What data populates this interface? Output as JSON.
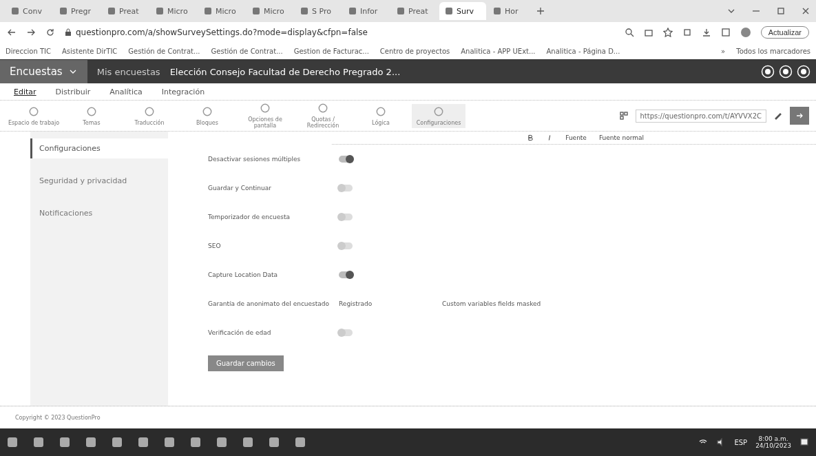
{
  "browser": {
    "tabs": [
      {
        "title": "Conv",
        "selected": false
      },
      {
        "title": "Pregr",
        "selected": false
      },
      {
        "title": "Preat",
        "selected": false
      },
      {
        "title": "Micro",
        "selected": false
      },
      {
        "title": "Micro",
        "selected": false
      },
      {
        "title": "Micro",
        "selected": false
      },
      {
        "title": "S Pro",
        "selected": false
      },
      {
        "title": "Infor",
        "selected": false
      },
      {
        "title": "Preat",
        "selected": false
      },
      {
        "title": "Surv",
        "selected": true
      },
      {
        "title": "Hor",
        "selected": false
      }
    ],
    "url": "questionpro.com/a/showSurveySettings.do?mode=display&cfpn=false",
    "update_button": "Actualizar",
    "bookmarks": [
      "Direccion TIC",
      "Asistente DirTIC",
      "Gestión de Contrat...",
      "Gestión de Contrat...",
      "Gestion de Facturac...",
      "Centro de proyectos",
      "Analitica - APP UExt...",
      "Analitica - Página D..."
    ],
    "more_bookmarks": "»",
    "all_bookmarks": "Todos los marcadores"
  },
  "app_bar": {
    "product": "Encuestas",
    "breadcrumb": "Mis encuestas",
    "survey_title": "Elección Consejo Facultad de Derecho Pregrado 2..."
  },
  "menu": [
    {
      "label": "Editar",
      "selected": true
    },
    {
      "label": "Distribuir",
      "selected": false
    },
    {
      "label": "Analítica",
      "selected": false
    },
    {
      "label": "Integración",
      "selected": false
    }
  ],
  "toolbar": [
    {
      "label": "Espacio de trabajo",
      "selected": false
    },
    {
      "label": "Temas",
      "selected": false
    },
    {
      "label": "Traducción",
      "selected": false
    },
    {
      "label": "Bloques",
      "selected": false
    },
    {
      "label": "Opciones de pantalla",
      "selected": false
    },
    {
      "label": "Quotas / Redirección",
      "selected": false
    },
    {
      "label": "Lógica",
      "selected": false
    },
    {
      "label": "Configuraciones",
      "selected": true
    }
  ],
  "share_url": "https://questionpro.com/t/AYVVX2C",
  "editor_toolbar": {
    "font": "Fuente",
    "style": "Fuente normal"
  },
  "sidebar": [
    {
      "label": "Configuraciones",
      "selected": true
    },
    {
      "label": "Seguridad y privacidad",
      "selected": false
    },
    {
      "label": "Notificaciones",
      "selected": false
    }
  ],
  "settings": [
    {
      "kind": "toggle",
      "label": "Desactivar sesiones múltiples",
      "on": true
    },
    {
      "kind": "toggle",
      "label": "Guardar y Continuar",
      "on": false
    },
    {
      "kind": "toggle",
      "label": "Temporizador de encuesta",
      "on": false
    },
    {
      "kind": "toggle",
      "label": "SEO",
      "on": false
    },
    {
      "kind": "toggle",
      "label": "Capture Location Data",
      "on": true
    },
    {
      "kind": "text",
      "label": "Garantía de anonimato del encuestado",
      "value": "Registrado",
      "note": "Custom variables fields masked"
    },
    {
      "kind": "toggle",
      "label": "Verificación de edad",
      "on": false
    }
  ],
  "save_button": "Guardar cambios",
  "footer": "Copyright © 2023 QuestionPro",
  "taskbar": {
    "language": "ESP",
    "time": "8:00 a.m.",
    "date": "24/10/2023"
  }
}
